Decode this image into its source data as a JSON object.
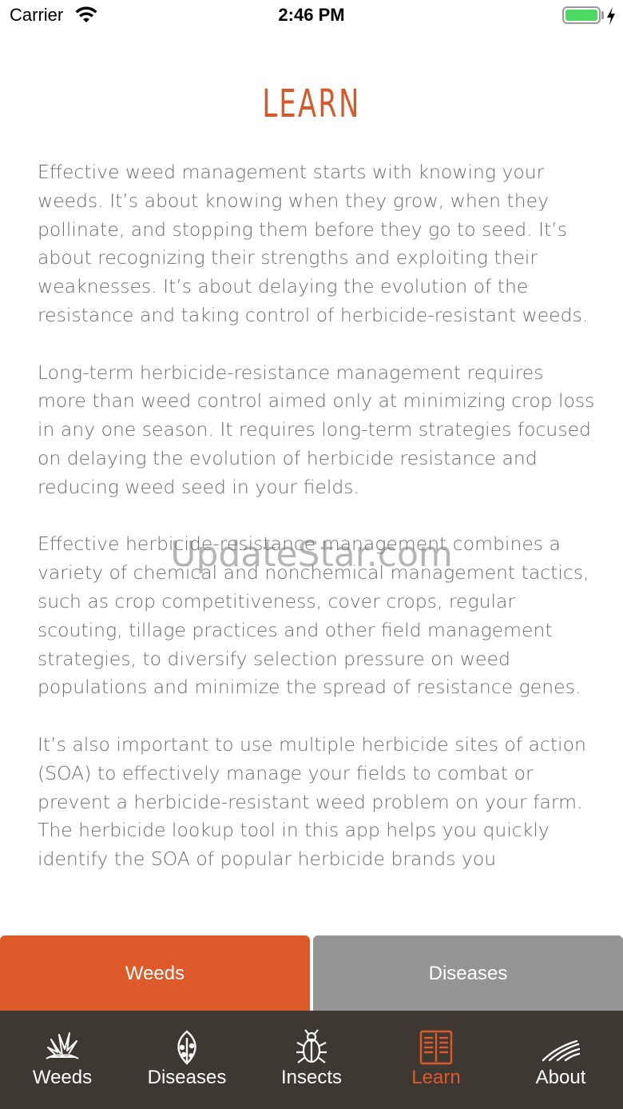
{
  "status_bar": {
    "carrier": "Carrier",
    "time": "2:46 PM"
  },
  "page": {
    "title": "LEARN",
    "paragraphs": [
      "Effective weed management starts with knowing your weeds. It’s about knowing when they grow, when they pollinate, and stopping them before they go to seed. It’s about recognizing their strengths and exploiting their weaknesses. It’s about delaying the evolution of the resistance and taking control of herbicide-resistant weeds.",
      "Long-term herbicide-resistance management requires more than weed control aimed only at minimizing crop loss in any one season. It requires long-term strategies focused on delaying the evolution of herbicide resistance and reducing weed seed in your fields.",
      "Effective herbicide-resistance management combines a variety of chemical and nonchemical management tactics, such as crop competitiveness, cover crops, regular scouting, tillage practices and other field management strategies, to diversify selection pressure on weed populations and minimize the spread of resistance genes.",
      "It’s also important to use multiple herbicide sites of action (SOA) to effectively manage your fields to combat or prevent a herbicide-resistant weed problem on your farm. The herbicide lookup tool in this app helps you quickly identify the SOA of popular herbicide brands you"
    ]
  },
  "watermark": "UpdateStar.com",
  "segments": {
    "weeds": "Weeds",
    "diseases": "Diseases"
  },
  "tabs": [
    {
      "label": "Weeds",
      "icon": "weed-plant-icon"
    },
    {
      "label": "Diseases",
      "icon": "leaf-disease-icon"
    },
    {
      "label": "Insects",
      "icon": "bug-icon"
    },
    {
      "label": "Learn",
      "icon": "book-icon"
    },
    {
      "label": "About",
      "icon": "field-rows-icon"
    }
  ],
  "colors": {
    "accent": "#de5a2b",
    "tab_bar": "#3e3833",
    "segment_inactive": "#959595"
  }
}
